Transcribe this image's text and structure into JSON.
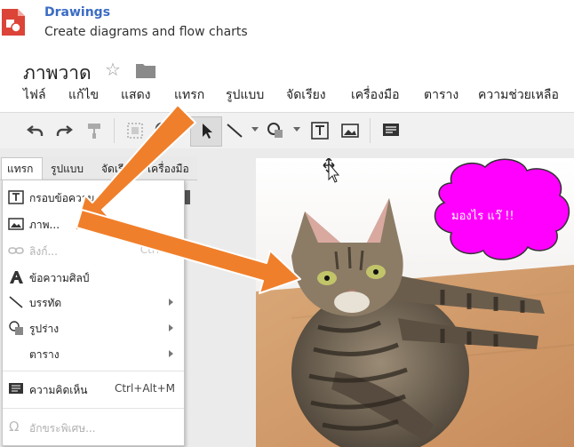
{
  "app": {
    "name": "Drawings",
    "subtitle": "Create diagrams and flow charts",
    "doc_title": "ภาพวาด"
  },
  "menubar": {
    "items": [
      "ไฟล์",
      "แก้ไข",
      "แสดง",
      "แทรก",
      "รูปแบบ",
      "จัดเรียง",
      "เครื่องมือ",
      "ตาราง",
      "ความช่วยเหลือ"
    ]
  },
  "toolbar": {
    "icons": [
      "undo-icon",
      "redo-icon",
      "paint-format-icon",
      "select-frame-icon",
      "zoom-icon",
      "select-cursor-icon",
      "line-icon",
      "shape-icon",
      "textbox-icon",
      "image-icon",
      "comment-icon"
    ]
  },
  "panel_tabs": [
    "แทรก",
    "รูปแบบ",
    "จัดเรียง",
    "เครื่องมือ"
  ],
  "insert_menu": {
    "items": [
      {
        "label": "กรอบข้อความ",
        "icon": "textbox-icon",
        "shortcut": "",
        "enabled": true,
        "submenu": false
      },
      {
        "label": "ภาพ...",
        "icon": "image-icon",
        "shortcut": "",
        "enabled": true,
        "submenu": false
      },
      {
        "label": "ลิงก์...",
        "icon": "link-icon",
        "shortcut": "Ctrl+K",
        "enabled": false,
        "submenu": false
      },
      {
        "label": "ข้อความศิลป์",
        "icon": "word-art-icon",
        "shortcut": "",
        "enabled": true,
        "submenu": false
      },
      {
        "label": "บรรทัด",
        "icon": "line-icon",
        "shortcut": "",
        "enabled": true,
        "submenu": true
      },
      {
        "label": "รูปร่าง",
        "icon": "shape-icon",
        "shortcut": "",
        "enabled": true,
        "submenu": true
      },
      {
        "label": "ตาราง",
        "icon": "",
        "shortcut": "",
        "enabled": true,
        "submenu": true
      },
      {
        "label": "ความคิดเห็น",
        "icon": "comment-icon",
        "shortcut": "Ctrl+Alt+M",
        "enabled": true,
        "submenu": false
      },
      {
        "label": "อักขระพิเศษ...",
        "icon": "omega-icon",
        "shortcut": "",
        "enabled": false,
        "submenu": false
      }
    ]
  },
  "canvas": {
    "bubble_text": "มองไร แว๊ !!"
  },
  "colors": {
    "brand_blue": "#3b6cc4",
    "arrow_orange": "#f07f2b",
    "bubble_magenta": "#ff00ff",
    "logo_red": "#db4437"
  }
}
